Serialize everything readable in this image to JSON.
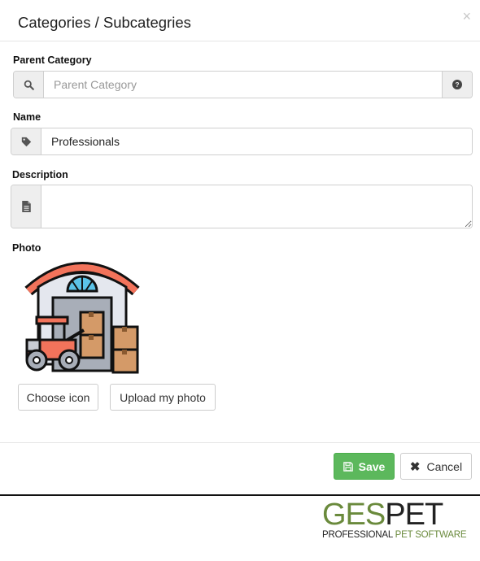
{
  "modal": {
    "title": "Categories / Subcategries",
    "close_label": "×"
  },
  "form": {
    "parent_category": {
      "label": "Parent Category",
      "placeholder": "Parent Category",
      "value": ""
    },
    "name": {
      "label": "Name",
      "value": "Professionals"
    },
    "description": {
      "label": "Description",
      "value": ""
    },
    "photo": {
      "label": "Photo",
      "image": "warehouse-forklift-icon",
      "choose_icon_label": "Choose icon",
      "upload_label": "Upload my photo"
    }
  },
  "footer": {
    "save_label": "Save",
    "cancel_label": "Cancel"
  },
  "logo": {
    "brand_part1": "GES",
    "brand_part2": "PET",
    "tagline_part1": "PROFESSIONAL ",
    "tagline_part2": "PET SOFTWARE",
    "green": "#6a8a3c",
    "dark": "#222222"
  },
  "colors": {
    "save_button": "#5cb85c"
  }
}
